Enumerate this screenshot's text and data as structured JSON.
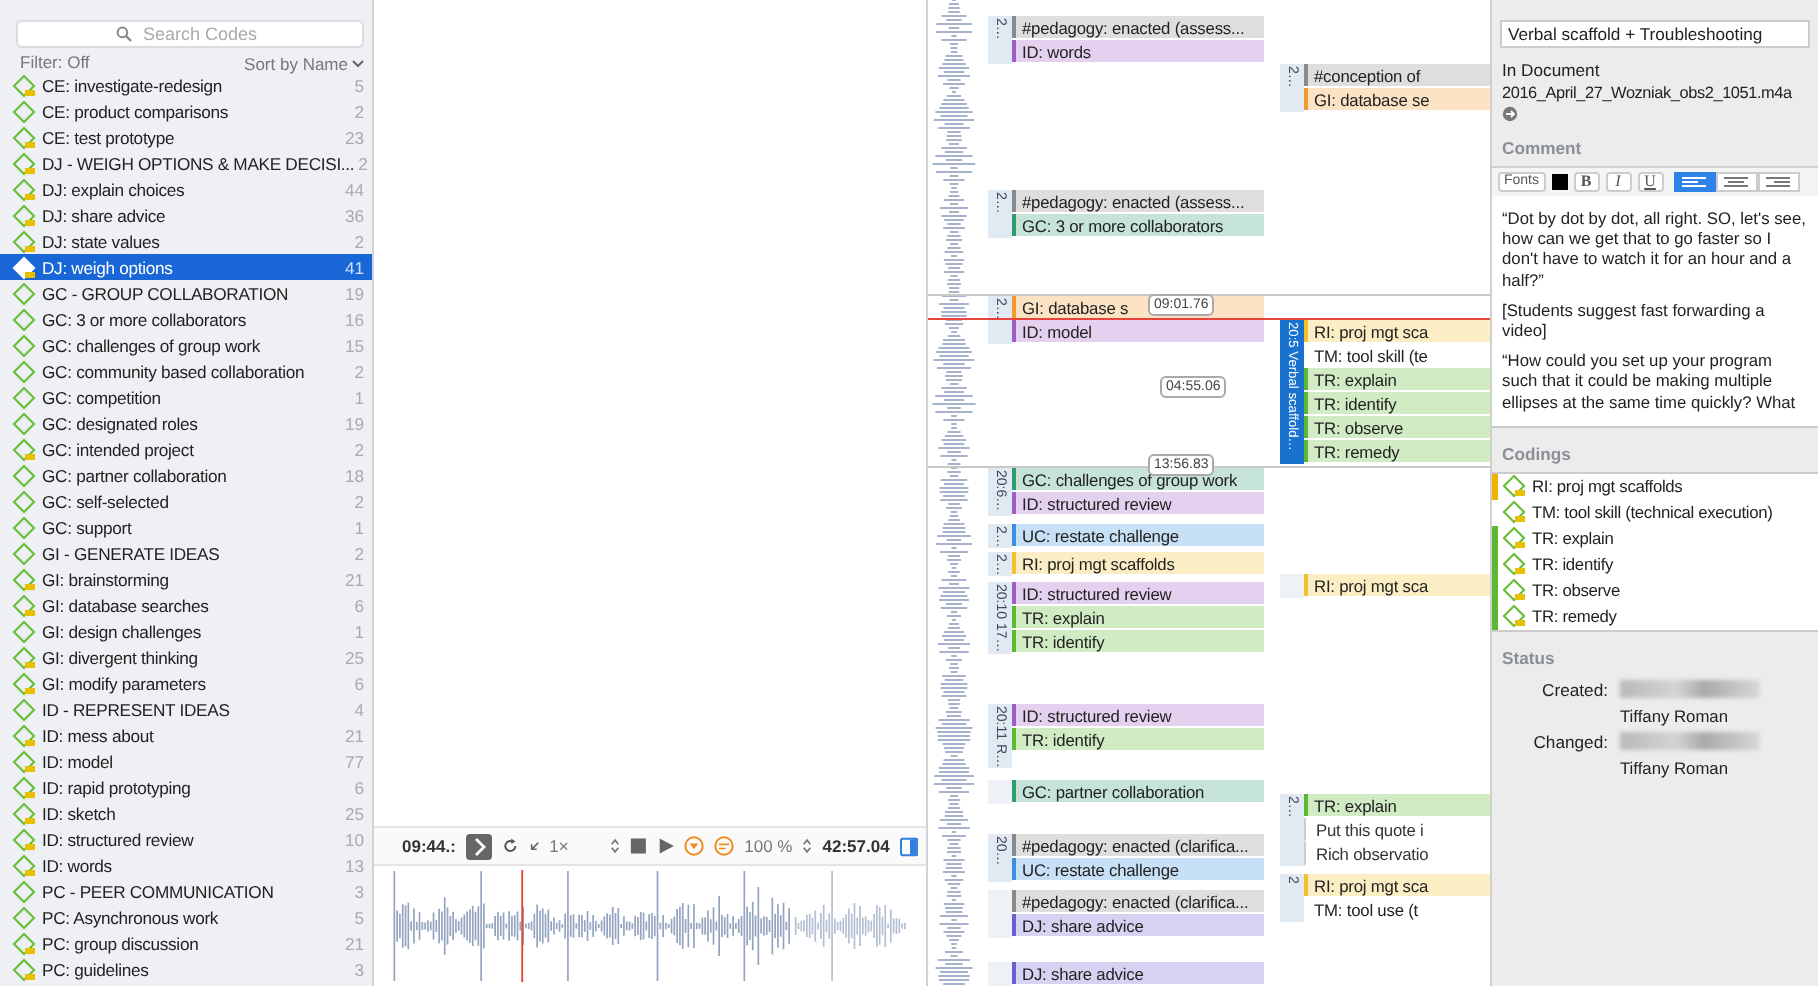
{
  "code_browser": {
    "search": {
      "placeholder": "Search Codes"
    },
    "filter": "Filter: Off",
    "sort": "Sort by Name",
    "codes": [
      {
        "name": "CE: investigate-redesign",
        "count": "5",
        "memo": true,
        "selected": false
      },
      {
        "name": "CE: product comparisons",
        "count": "2",
        "memo": false,
        "selected": false
      },
      {
        "name": "CE: test prototype",
        "count": "23",
        "memo": true,
        "selected": false
      },
      {
        "name": "DJ - WEIGH OPTIONS & MAKE DECISI...",
        "count": "2",
        "memo": true,
        "selected": false
      },
      {
        "name": "DJ: explain choices",
        "count": "44",
        "memo": true,
        "selected": false
      },
      {
        "name": "DJ: share advice",
        "count": "36",
        "memo": true,
        "selected": false
      },
      {
        "name": "DJ: state values",
        "count": "2",
        "memo": true,
        "selected": false
      },
      {
        "name": "DJ: weigh options",
        "count": "41",
        "memo": true,
        "selected": true
      },
      {
        "name": "GC - GROUP COLLABORATION",
        "count": "19",
        "memo": false,
        "selected": false
      },
      {
        "name": "GC: 3 or more collaborators",
        "count": "16",
        "memo": false,
        "selected": false
      },
      {
        "name": "GC: challenges of group work",
        "count": "15",
        "memo": false,
        "selected": false
      },
      {
        "name": "GC: community based collaboration",
        "count": "2",
        "memo": false,
        "selected": false
      },
      {
        "name": "GC: competition",
        "count": "1",
        "memo": false,
        "selected": false
      },
      {
        "name": "GC: designated roles",
        "count": "19",
        "memo": false,
        "selected": false
      },
      {
        "name": "GC: intended project",
        "count": "2",
        "memo": true,
        "selected": false
      },
      {
        "name": "GC: partner collaboration",
        "count": "18",
        "memo": false,
        "selected": false
      },
      {
        "name": "GC: self-selected",
        "count": "2",
        "memo": false,
        "selected": false
      },
      {
        "name": "GC: support",
        "count": "1",
        "memo": false,
        "selected": false
      },
      {
        "name": "GI - GENERATE IDEAS",
        "count": "2",
        "memo": false,
        "selected": false
      },
      {
        "name": "GI: brainstorming",
        "count": "21",
        "memo": true,
        "selected": false
      },
      {
        "name": "GI: database searches",
        "count": "6",
        "memo": true,
        "selected": false
      },
      {
        "name": "GI: design challenges",
        "count": "1",
        "memo": false,
        "selected": false
      },
      {
        "name": "GI: divergent thinking",
        "count": "25",
        "memo": true,
        "selected": false
      },
      {
        "name": "GI: modify parameters",
        "count": "6",
        "memo": true,
        "selected": false
      },
      {
        "name": "ID - REPRESENT IDEAS",
        "count": "4",
        "memo": false,
        "selected": false
      },
      {
        "name": "ID: mess about",
        "count": "21",
        "memo": true,
        "selected": false
      },
      {
        "name": "ID: model",
        "count": "77",
        "memo": true,
        "selected": false
      },
      {
        "name": "ID: rapid prototyping",
        "count": "6",
        "memo": true,
        "selected": false
      },
      {
        "name": "ID: sketch",
        "count": "25",
        "memo": true,
        "selected": false
      },
      {
        "name": "ID: structured review",
        "count": "10",
        "memo": true,
        "selected": false
      },
      {
        "name": "ID: words",
        "count": "13",
        "memo": true,
        "selected": false
      },
      {
        "name": "PC - PEER COMMUNICATION",
        "count": "3",
        "memo": false,
        "selected": false
      },
      {
        "name": "PC: Asynchronous work",
        "count": "5",
        "memo": false,
        "selected": false
      },
      {
        "name": "PC: group discussion",
        "count": "21",
        "memo": true,
        "selected": false
      },
      {
        "name": "PC: guidelines",
        "count": "3",
        "memo": true,
        "selected": false
      }
    ]
  },
  "player": {
    "position": "09:44.:",
    "speed": "1×",
    "volume": "100 %",
    "duration": "42:57.04"
  },
  "timeline": {
    "markers": [
      "09:01.76",
      "04:55.06",
      "13:56.83"
    ],
    "lanes": [
      {
        "groups": [
          {
            "stamp": "2…",
            "selected": false,
            "codes": [
              {
                "kind": "code",
                "label": "#pedagogy: enacted (assess...",
                "color": "#8a8a8a"
              },
              {
                "kind": "code",
                "label": "ID: words",
                "color": "#a05cc8"
              }
            ]
          },
          {
            "stamp": "2…",
            "selected": false,
            "codes": [
              {
                "kind": "code",
                "label": "#pedagogy: enacted (assess...",
                "color": "#8a8a8a"
              },
              {
                "kind": "code",
                "label": "GC: 3 or more collaborators",
                "color": "#2f9c6c"
              }
            ]
          },
          {
            "stamp": "2…",
            "selected": false,
            "codes": [
              {
                "kind": "code",
                "label": "GI: database s",
                "color": "#f29a2e"
              },
              {
                "kind": "code",
                "label": "ID: model",
                "color": "#a05cc8"
              }
            ]
          },
          {
            "stamp": "20:6…",
            "selected": false,
            "codes": [
              {
                "kind": "code",
                "label": "GC: challenges of group work",
                "color": "#2f9c6c"
              },
              {
                "kind": "code",
                "label": "ID: structured review",
                "color": "#a05cc8"
              }
            ]
          },
          {
            "stamp": "2…",
            "selected": false,
            "codes": [
              {
                "kind": "code",
                "label": "UC: restate challenge",
                "color": "#3b8fe0"
              }
            ]
          },
          {
            "stamp": "2…",
            "selected": false,
            "codes": [
              {
                "kind": "code",
                "label": "RI: proj mgt scaffolds",
                "color": "#f2c12e"
              }
            ]
          },
          {
            "stamp": "20:10 17…",
            "selected": false,
            "codes": [
              {
                "kind": "code",
                "label": "ID: structured review",
                "color": "#a05cc8"
              },
              {
                "kind": "code",
                "label": "TR: explain",
                "color": "#5bb830"
              },
              {
                "kind": "code",
                "label": "TR: identify",
                "color": "#5bb830"
              }
            ]
          },
          {
            "stamp": "20:11 R…",
            "selected": false,
            "codes": [
              {
                "kind": "code",
                "label": "ID: structured review",
                "color": "#a05cc8"
              },
              {
                "kind": "code",
                "label": "TR: identify",
                "color": "#5bb830"
              }
            ]
          },
          {
            "codes": [
              {
                "kind": "code",
                "label": "GC: partner collaboration",
                "color": "#2f9c6c"
              }
            ]
          },
          {
            "stamp": "20…",
            "selected": false,
            "codes": [
              {
                "kind": "code",
                "label": "#pedagogy: enacted (clarifica...",
                "color": "#8a8a8a"
              },
              {
                "kind": "code",
                "label": "UC: restate challenge",
                "color": "#3b8fe0"
              }
            ]
          },
          {
            "codes": [
              {
                "kind": "code",
                "label": "#pedagogy: enacted (clarifica...",
                "color": "#8a8a8a"
              },
              {
                "kind": "code",
                "label": "DJ: share advice",
                "color": "#6a5fd0"
              }
            ]
          },
          {
            "codes": [
              {
                "kind": "code",
                "label": "DJ: share advice",
                "color": "#6a5fd0"
              }
            ]
          }
        ]
      },
      {
        "groups": [
          {
            "stamp": "2…",
            "selected": false,
            "codes": [
              {
                "kind": "code",
                "label": "#conception of",
                "color": "#8a8a8a"
              },
              {
                "kind": "code",
                "label": "GI: database se",
                "color": "#f29a2e"
              }
            ]
          },
          {
            "stamp": "20:5 Verbal scaffold…",
            "selected": true,
            "codes": [
              {
                "kind": "code",
                "label": "RI: proj mgt sca",
                "color": "#f2c12e"
              },
              {
                "kind": "code",
                "label": "TM: tool skill (te"
              },
              {
                "kind": "code",
                "label": "TR: explain",
                "color": "#5bb830"
              },
              {
                "kind": "code",
                "label": "TR: identify",
                "color": "#5bb830"
              },
              {
                "kind": "code",
                "label": "TR: observe",
                "color": "#5bb830"
              },
              {
                "kind": "code",
                "label": "TR: remedy",
                "color": "#5bb830"
              }
            ]
          },
          {
            "codes": [
              {
                "kind": "code",
                "label": "RI: proj mgt sca",
                "color": "#f2c12e"
              }
            ]
          },
          {
            "stamp": "2…",
            "selected": false,
            "codes": [
              {
                "kind": "code",
                "label": "TR: explain",
                "color": "#5bb830"
              },
              {
                "kind": "note",
                "label": "Put this quote i"
              },
              {
                "kind": "note",
                "label": "Rich observatio"
              }
            ]
          },
          {
            "stamp": "2",
            "selected": false,
            "codes": [
              {
                "kind": "code",
                "label": "RI: proj mgt sca",
                "color": "#f2c12e"
              },
              {
                "kind": "code",
                "label": "TM: tool use (t"
              }
            ]
          }
        ]
      }
    ]
  },
  "inspector": {
    "title": "Verbal scaffold + Troubleshooting",
    "document_label": "In Document",
    "document": "2016_April_27_Wozniak_obs2_1051.m4a",
    "comment_heading": "Comment",
    "toolbar": {
      "fonts": "Fonts",
      "styles": [
        "B",
        "I",
        "U"
      ],
      "alignments": [
        {
          "kind": "left",
          "selected": true
        },
        {
          "kind": "center",
          "selected": false
        },
        {
          "kind": "right",
          "selected": false
        }
      ]
    },
    "comment": [
      "“Dot by dot by dot, all right. SO, let's see, how can we get that to go faster so I don't have to watch it for an hour and a half?”",
      "[Students suggest fast forwarding a video]",
      "“How could you set up your program such that it could be making multiple ellipses at the same time quickly? What"
    ],
    "codings_heading": "Codings",
    "codings": [
      {
        "label": "RI: proj mgt scaffolds",
        "color": "#f0b400"
      },
      {
        "label": "TM: tool skill (technical execution)"
      },
      {
        "label": "TR: explain",
        "color": "#5bb830"
      },
      {
        "label": "TR: identify",
        "color": "#5bb830"
      },
      {
        "label": "TR: observe",
        "color": "#5bb830"
      },
      {
        "label": "TR: remedy",
        "color": "#5bb830"
      }
    ],
    "status_heading": "Status",
    "created_label": "Created:",
    "created_by": "Tiffany Roman",
    "changed_label": "Changed:",
    "changed_by": "Tiffany Roman"
  }
}
